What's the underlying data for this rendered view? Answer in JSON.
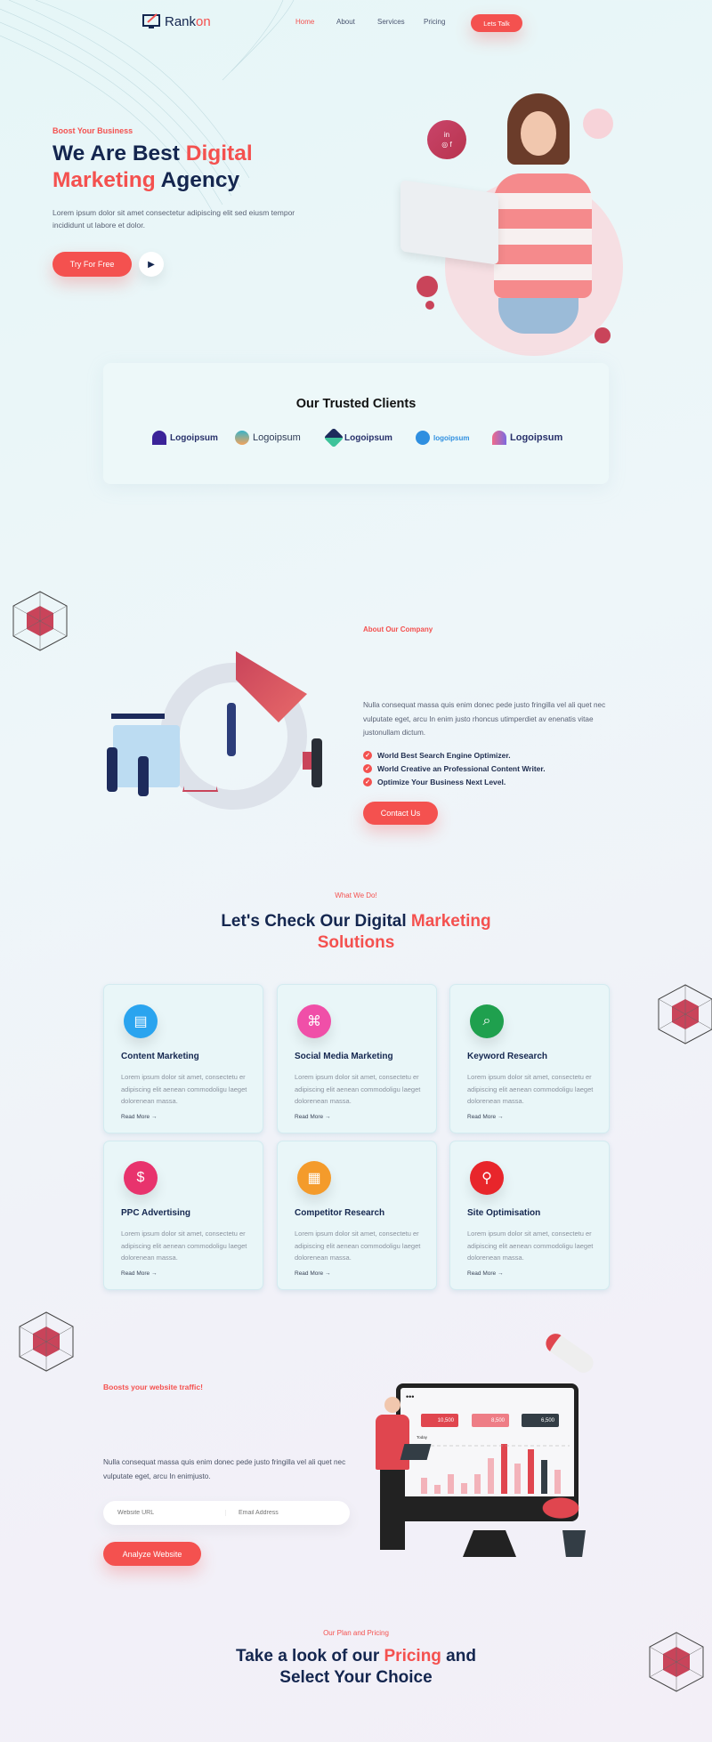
{
  "brand": {
    "name_a": "Rank",
    "name_b": "on"
  },
  "nav": {
    "items": [
      "Home",
      "About",
      "Services",
      "Pricing"
    ],
    "cta": "Lets Talk"
  },
  "hero": {
    "eyebrow": "Boost Your Business",
    "title_1a": "We Are Best ",
    "title_1b": "Digital",
    "title_2a": "Marketing",
    "title_2b": " Agency",
    "text": "Lorem ipsum dolor sit amet consectetur adipiscing elit sed eiusm tempor incididunt ut labore et dolor.",
    "cta": "Try For Free",
    "social": [
      "linkedin-icon",
      "instagram-icon",
      "facebook-icon"
    ]
  },
  "clients": {
    "title": "Our Trusted Clients",
    "logos": [
      "Logoipsum",
      "Logoipsum",
      "Logoipsum",
      "logoipsum",
      "Logoipsum"
    ]
  },
  "about": {
    "eyebrow": "About Our Company",
    "text": "Nulla consequat massa quis enim donec pede justo fringilla vel ali quet nec vulputate eget, arcu In enim justo rhoncus utimperdiet av enenatis vitae justonullam dictum.",
    "list": [
      "World Best Search Engine Optimizer.",
      "World Creative an Professional Content Writer.",
      "Optimize Your Business Next Level."
    ],
    "cta": "Contact Us"
  },
  "services": {
    "eyebrow": "What We Do!",
    "title_a": "Let's Check Our Digital ",
    "title_b": "Marketing",
    "title_c": "Solutions",
    "items": [
      {
        "title": "Content Marketing",
        "text": "Lorem ipsum dolor sit amet, consectetu er adipiscing elit aenean commodoligu laeget dolorenean massa.",
        "link": "Read More →",
        "color": "#2aa4ef",
        "icon": "content-icon"
      },
      {
        "title": "Social Media Marketing",
        "text": "Lorem ipsum dolor sit amet, consectetu er adipiscing elit aenean commodoligu laeget dolorenean massa.",
        "link": "Read More →",
        "color": "#f04fa8",
        "icon": "social-icon"
      },
      {
        "title": "Keyword Research",
        "text": "Lorem ipsum dolor sit amet, consectetu er adipiscing elit aenean commodoligu laeget dolorenean massa.",
        "link": "Read More →",
        "color": "#1fa04e",
        "icon": "seo-search-icon"
      },
      {
        "title": "PPC Advertising",
        "text": "Lorem ipsum dolor sit amet, consectetu er adipiscing elit aenean commodoligu laeget dolorenean massa.",
        "link": "Read More →",
        "color": "#e8336d",
        "icon": "ppc-icon"
      },
      {
        "title": "Competitor Research",
        "text": "Lorem ipsum dolor sit amet, consectetu er adipiscing elit aenean commodoligu laeget dolorenean massa.",
        "link": "Read More →",
        "color": "#f49b2b",
        "icon": "competitor-icon"
      },
      {
        "title": "Site Optimisation",
        "text": "Lorem ipsum dolor sit amet, consectetu er adipiscing elit aenean commodoligu laeget dolorenean massa.",
        "link": "Read More →",
        "color": "#e8262b",
        "icon": "optimisation-icon"
      }
    ]
  },
  "traffic": {
    "eyebrow": "Boosts your website traffic!",
    "text": "Nulla consequat massa quis enim donec pede justo fringilla vel ali quet nec vulputate eget, arcu In enimjusto.",
    "url_placeholder": "Website URL",
    "email_placeholder": "Email Address",
    "cta": "Analyze  Website",
    "stats": [
      "10,500",
      "8,500",
      "6,500"
    ],
    "today": "Today"
  },
  "pricing": {
    "eyebrow": "Our Plan and Pricing",
    "title_a": "Take a look of our ",
    "title_b": "Pricing",
    "title_c": " and",
    "title_d": "Select Your Choice"
  },
  "colors": {
    "accent": "#f4514f",
    "navy": "#14264f"
  }
}
